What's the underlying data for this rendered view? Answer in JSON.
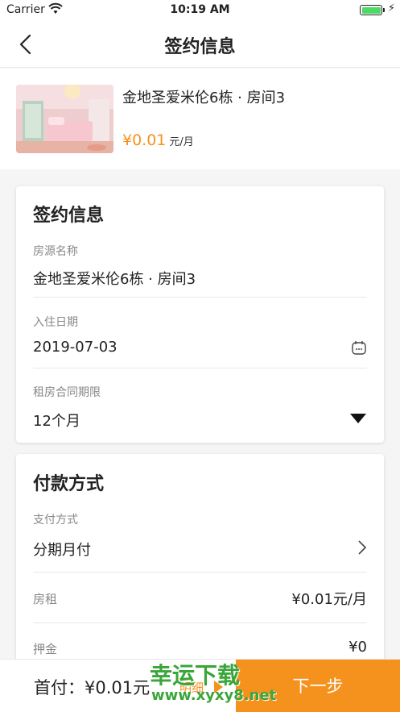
{
  "status_bar": {
    "carrier": "Carrier",
    "time": "10:19 AM"
  },
  "nav": {
    "title": "签约信息"
  },
  "room": {
    "name": "金地圣爱米伦6栋 · 房间3",
    "price": "¥0.01",
    "unit": "元/月"
  },
  "sign_info": {
    "title": "签约信息",
    "listing_label": "房源名称",
    "listing_value": "金地圣爱米伦6栋 · 房间3",
    "checkin_label": "入住日期",
    "checkin_value": "2019-07-03",
    "lease_label": "租房合同期限",
    "lease_value": "12个月"
  },
  "payment": {
    "title": "付款方式",
    "method_label": "支付方式",
    "method_value": "分期月付",
    "rent_label": "房租",
    "rent_value": "¥0.01元/月",
    "deposit_label": "押金",
    "deposit_value": "¥0"
  },
  "bottom": {
    "first_pay": "首付：¥0.01元",
    "detail": "明细",
    "next": "下一步"
  },
  "watermark": {
    "line1": "幸运下载",
    "line2": "www.xyxy8.net"
  },
  "colors": {
    "accent": "#f5921e",
    "battery": "#4cd964",
    "watermark": "#3aa63a"
  },
  "icons": [
    "wifi-icon",
    "battery-icon",
    "charging-icon",
    "back-arrow-icon",
    "calendar-icon",
    "dropdown-triangle-icon",
    "chevron-right-icon",
    "detail-arrow-icon"
  ]
}
